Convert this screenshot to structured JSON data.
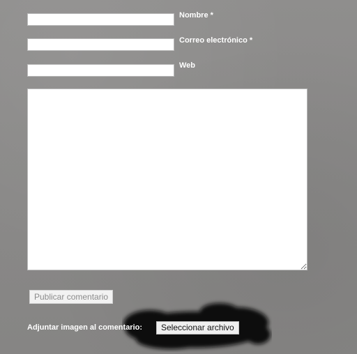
{
  "form": {
    "name_label": "Nombre *",
    "name_value": "",
    "email_label": "Correo electrónico *",
    "email_value": "",
    "web_label": "Web",
    "web_value": "",
    "comment_value": "",
    "submit_label": "Publicar comentario",
    "attach_label": "Adjuntar imagen al comentario:",
    "file_button_label": "Seleccionar archivo"
  },
  "colors": {
    "background": "#8a8988",
    "label_text": "#ffffff",
    "input_background": "#ffffff",
    "submit_text": "#8b8b8b"
  }
}
